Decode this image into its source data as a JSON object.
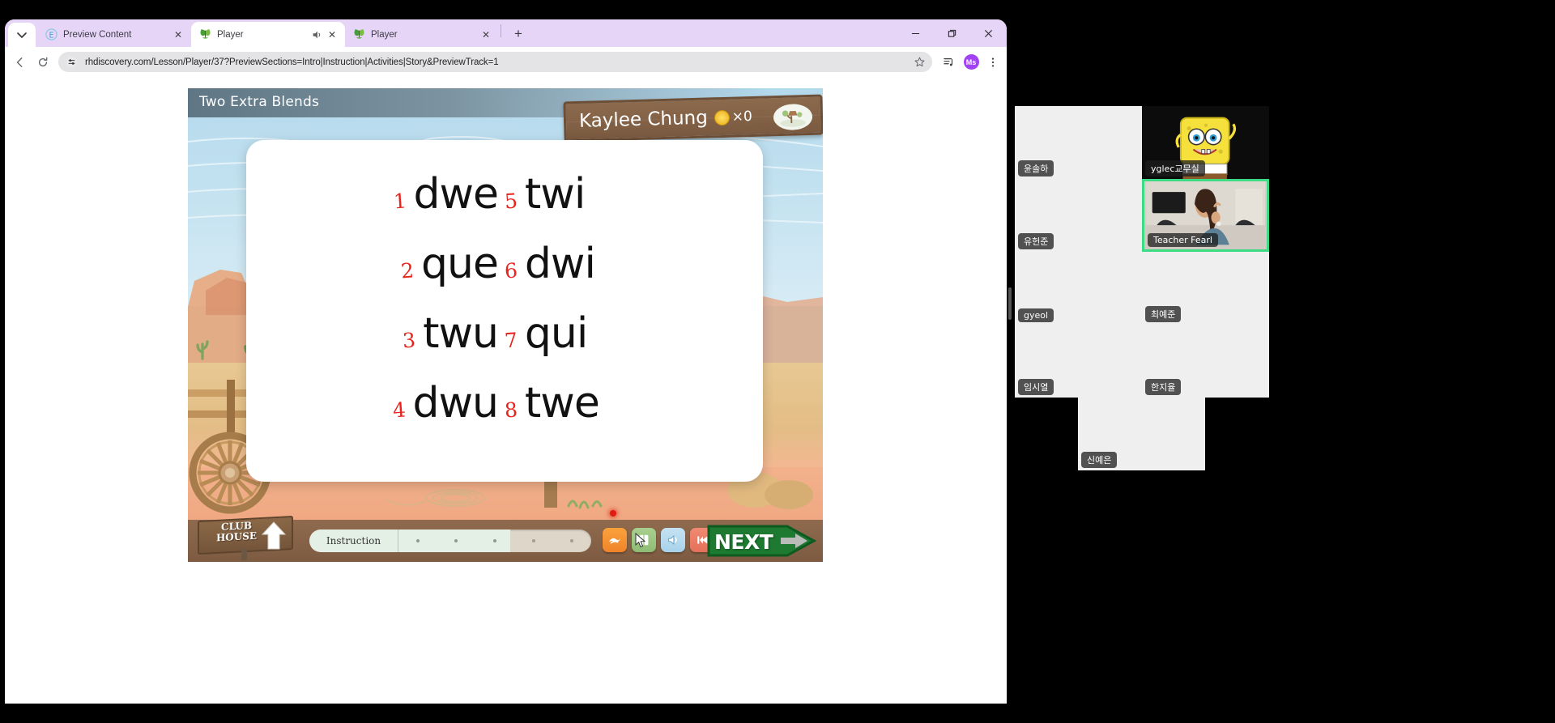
{
  "browser": {
    "tab_search_icon": "chevron-down-icon",
    "tabs": [
      {
        "title": "Preview Content",
        "favicon": "globe-e-icon",
        "active": false,
        "audio": false
      },
      {
        "title": "Player",
        "favicon": "butterfly-icon",
        "active": true,
        "audio": true
      },
      {
        "title": "Player",
        "favicon": "butterfly-icon",
        "active": false,
        "audio": false
      }
    ],
    "new_tab_label": "+",
    "window_controls": {
      "minimize": "minimize-icon",
      "maximize": "restore-icon",
      "close": "close-icon"
    },
    "back_icon": "arrow-left-icon",
    "reload_icon": "reload-icon",
    "site_info_icon": "tune-icon",
    "url": "rhdiscovery.com/Lesson/Player/37?PreviewSections=Intro|Instruction|Activities|Story&PreviewTrack=1",
    "bookmark_icon": "star-outline-icon",
    "media_icon": "media-playlist-icon",
    "profile_initials": "Ms",
    "menu_icon": "kebab-menu-icon"
  },
  "lesson": {
    "title": "Two Extra Blends",
    "student_name": "Kaylee Chung",
    "coin_icon": "gold-coin-icon",
    "coin_count": "×0",
    "badge_icon": "treehouse-badge-icon",
    "words": [
      {
        "num": "1",
        "word": "dwe"
      },
      {
        "num": "2",
        "word": "que"
      },
      {
        "num": "3",
        "word": "twu"
      },
      {
        "num": "4",
        "word": "dwu"
      },
      {
        "num": "5",
        "word": "twi"
      },
      {
        "num": "6",
        "word": "dwi"
      },
      {
        "num": "7",
        "word": "qui"
      },
      {
        "num": "8",
        "word": "twe"
      }
    ],
    "toolbar": {
      "clubhouse_line1": "CLUB",
      "clubhouse_line2": "HOUSE",
      "clubhouse_arrow_icon": "arrow-up-icon",
      "section_label": "Instruction",
      "progress_dots_total": 5,
      "progress_dots_filled": 3,
      "buttons": [
        {
          "name": "bird-fly-icon",
          "color": "#f6912f"
        },
        {
          "name": "book-page-icon",
          "color": "#9cc783"
        },
        {
          "name": "speaker-icon",
          "color": "#b5daee"
        },
        {
          "name": "rewind-icon",
          "color": "#e87a64"
        }
      ],
      "next_label": "NEXT",
      "next_arrow_icon": "arrow-right-icon",
      "next_color": "#1d7a30"
    },
    "laser_pointer_icon": "red-laser-dot"
  },
  "video_panel": {
    "resize_handle_icon": "drag-handle-icon",
    "participants": [
      {
        "name": "윤솔하",
        "speaking": false,
        "kind": "blank"
      },
      {
        "name": "yglec교무실",
        "speaking": false,
        "kind": "avatar-spongebob"
      },
      {
        "name": "유헌준",
        "speaking": false,
        "kind": "blank"
      },
      {
        "name": "Teacher Fearl",
        "speaking": true,
        "kind": "camera"
      },
      {
        "name": "gyeol",
        "speaking": false,
        "kind": "blank"
      },
      {
        "name": "최예준",
        "speaking": false,
        "kind": "blank"
      },
      {
        "name": "임시열",
        "speaking": false,
        "kind": "blank"
      },
      {
        "name": "한지율",
        "speaking": false,
        "kind": "blank"
      },
      {
        "name": "신예은",
        "speaking": false,
        "kind": "blank"
      }
    ]
  }
}
